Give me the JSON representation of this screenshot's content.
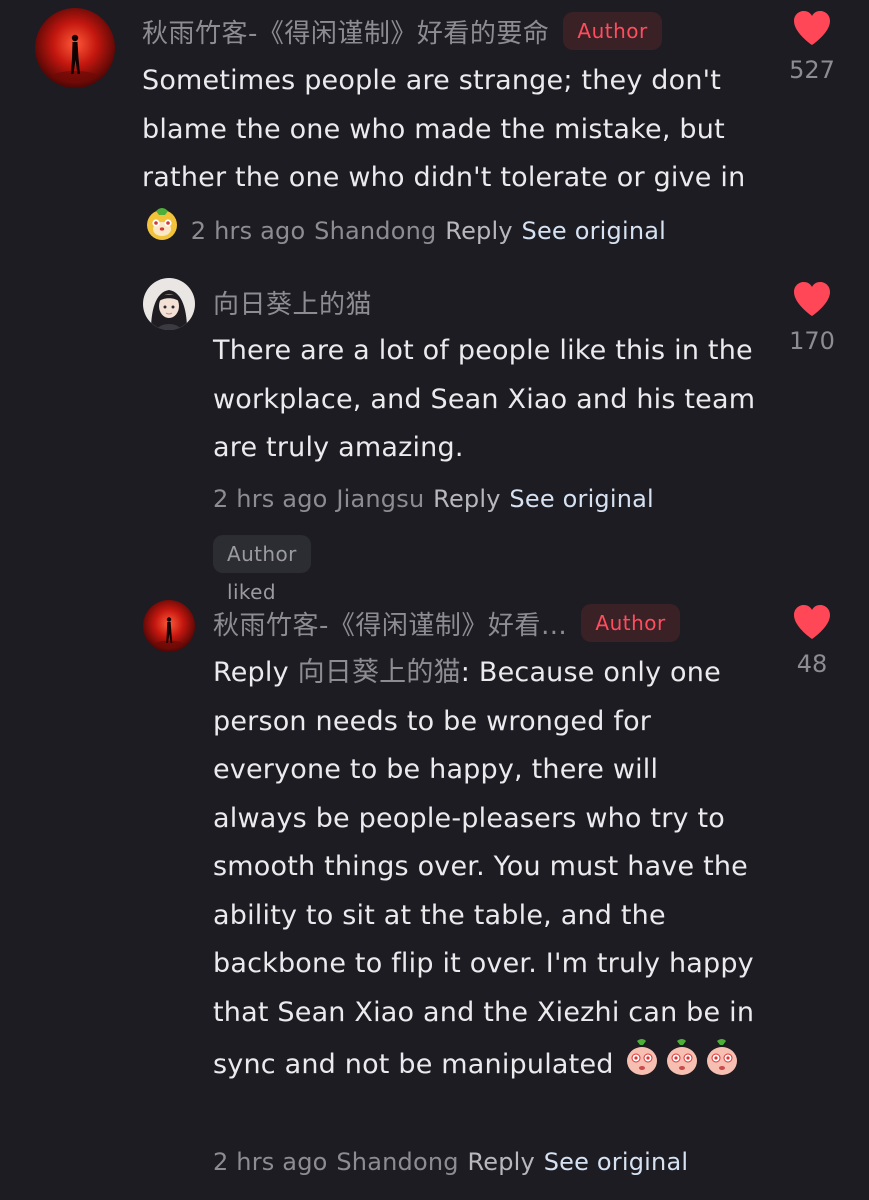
{
  "comments": [
    {
      "username": "秋雨竹客-《得闲谨制》好看的要命",
      "badge": "Author",
      "text": "Sometimes people are strange; they don't blame the one who made the mistake, but rather the one who didn't tolerate or give in",
      "time": "2 hrs ago",
      "location": "Shandong",
      "reply_label": "Reply",
      "see_original": "See original",
      "likes": "527",
      "avatar_icon": "silhouette-on-red-avatar",
      "emoji_icon": "dog-face-emoji"
    },
    {
      "username": "向日葵上的猫",
      "text": "There are a lot of people like this in the workplace, and Sean Xiao and his team are truly amazing.",
      "time": "2 hrs ago",
      "location": "Jiangsu",
      "reply_label": "Reply",
      "see_original": "See original",
      "likes": "170",
      "author_liked": "Author liked",
      "avatar_icon": "anime-girl-avatar"
    },
    {
      "username": "秋雨竹客-《得闲谨制》好看…",
      "badge": "Author",
      "reply_prefix": "Reply",
      "reply_to": "向日葵上的猫",
      "text": ": Because only one person needs to be wronged for everyone to be happy, there will always be people-pleasers who try to smooth things over. You must have the ability to sit at the table, and the backbone to flip it over. I'm truly happy that Sean Xiao and the Xiezhi can be in sync and not be manipulated",
      "time": "2 hrs ago",
      "location": "Shandong",
      "reply_label": "Reply",
      "see_original": "See original",
      "likes": "48",
      "avatar_icon": "silhouette-on-red-avatar",
      "emoji_icon": "peach-face-emoji"
    }
  ],
  "colors": {
    "background": "#1c1c22",
    "heart": "#ff4757",
    "badge_text": "#ff4d5e",
    "badge_bg": "#3a2126",
    "link": "#d6e2f2",
    "muted": "#8c8c92"
  }
}
